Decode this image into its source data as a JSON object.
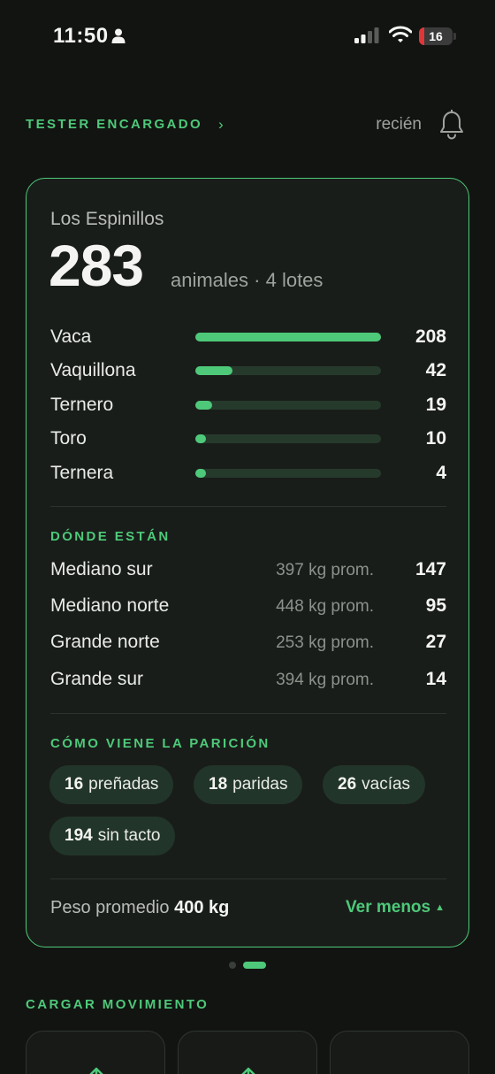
{
  "status_bar": {
    "time": "11:50",
    "battery": "16",
    "battery_level": 0.16
  },
  "header": {
    "account": "TESTER ENCARGADO",
    "account_chevron": "›",
    "updated": "recién"
  },
  "card": {
    "farm_name": "Los Espinillos",
    "total": "283",
    "total_sub": "animales · 4 lotes",
    "categories": [
      {
        "label": "Vaca",
        "value": "208",
        "fraction": 1.0
      },
      {
        "label": "Vaquillona",
        "value": "42",
        "fraction": 0.2
      },
      {
        "label": "Ternero",
        "value": "19",
        "fraction": 0.09
      },
      {
        "label": "Toro",
        "value": "10",
        "fraction": 0.05
      },
      {
        "label": "Ternera",
        "value": "4",
        "fraction": 0.02
      }
    ],
    "lotes_title": "DÓNDE ESTÁN",
    "lotes": [
      {
        "name": "Mediano sur",
        "avg_weight": "397 kg prom.",
        "count": "147"
      },
      {
        "name": "Mediano norte",
        "avg_weight": "448 kg prom.",
        "count": "95"
      },
      {
        "name": "Grande norte",
        "avg_weight": "253 kg prom.",
        "count": "27"
      },
      {
        "name": "Grande sur",
        "avg_weight": "394 kg prom.",
        "count": "14"
      }
    ],
    "paricion_title": "CÓMO VIENE LA PARICIÓN",
    "paricion": [
      {
        "count": "16",
        "label": "preñadas"
      },
      {
        "count": "18",
        "label": "paridas"
      },
      {
        "count": "26",
        "label": "vacías"
      },
      {
        "count": "194",
        "label": "sin tacto"
      }
    ],
    "peso_label": "Peso promedio",
    "peso_value": "400 kg",
    "toggle_label": "Ver menos",
    "toggle_icon": "▲"
  },
  "pager": {
    "pages": 2,
    "active": 2
  },
  "cargar_title": "CARGAR MOVIMIENTO",
  "colors": {
    "accent": "#4ec97a",
    "background": "#121411",
    "card": "#191d19",
    "chip": "#22352a"
  }
}
